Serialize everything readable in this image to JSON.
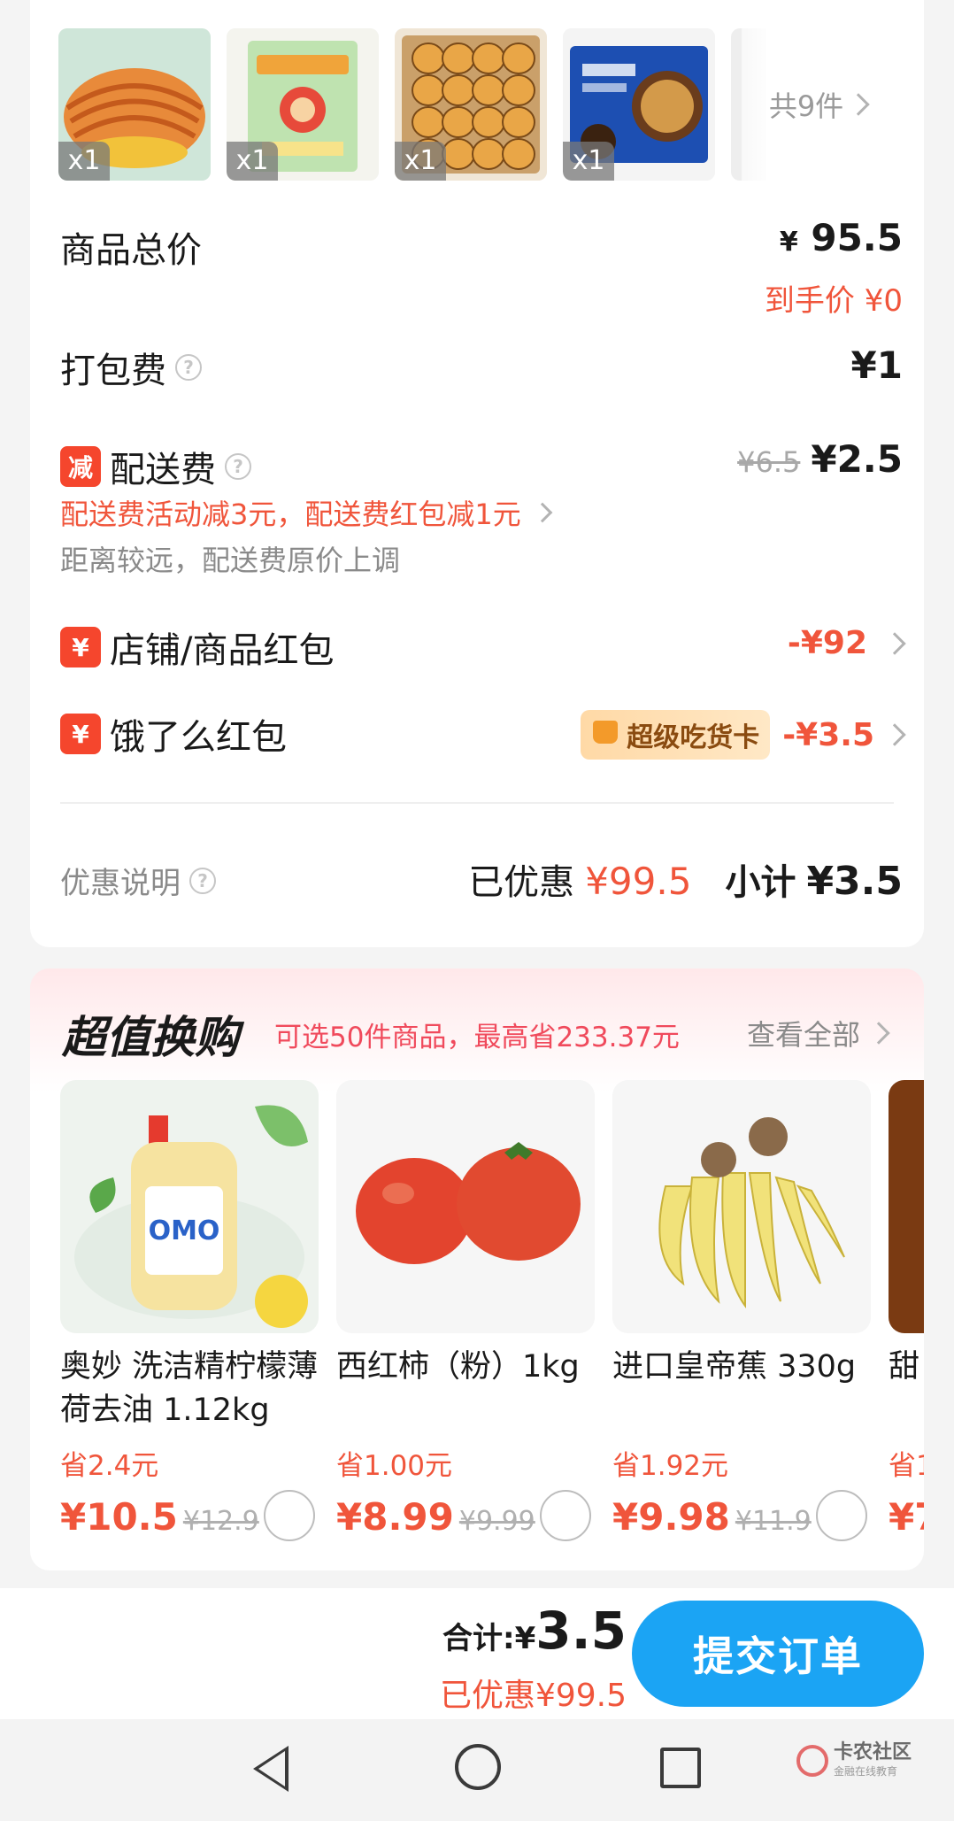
{
  "items": {
    "thumbs": [
      {
        "qty": "x1",
        "name": "pastry"
      },
      {
        "qty": "x1",
        "name": "snack-box"
      },
      {
        "qty": "x1",
        "name": "bread-rolls"
      },
      {
        "qty": "x1",
        "name": "oreo-box"
      }
    ],
    "more_label": "共9件"
  },
  "summary": {
    "goods_total_label": "商品总价",
    "goods_total_currency": "¥",
    "goods_total_value": "95.5",
    "final_price": "到手价 ¥0",
    "packing_label": "打包费",
    "packing_value": "¥1",
    "delivery_badge": "减",
    "delivery_label": "配送费",
    "delivery_original": "¥6.5",
    "delivery_value": "¥2.5",
    "delivery_promo": "配送费活动减3元，配送费红包减1元",
    "delivery_note": "距离较远，配送费原价上调",
    "shop_coupon_badge": "¥",
    "shop_coupon_label": "店铺/商品红包",
    "shop_coupon_value": "-¥92",
    "ele_coupon_badge": "¥",
    "ele_coupon_label": "饿了么红包",
    "super_card": "超级吃货卡",
    "ele_coupon_value": "-¥3.5",
    "discount_info_label": "优惠说明",
    "discounted_label": "已优惠",
    "discounted_value": "¥99.5",
    "subtotal_label": "小计",
    "subtotal_value": "¥3.5"
  },
  "exchange": {
    "title": "超值换购",
    "subtitle": "可选50件商品，最高省233.37元",
    "view_all": "查看全部",
    "products": [
      {
        "name": "奥妙 洗洁精柠檬薄荷去油 1.12kg",
        "save": "省2.4元",
        "price": "¥10.5",
        "orig": "¥12.9"
      },
      {
        "name": "西红柿（粉）1kg",
        "save": "省1.00元",
        "price": "¥8.99",
        "orig": "¥9.99"
      },
      {
        "name": "进口皇帝蕉 330g",
        "save": "省1.92元",
        "price": "¥9.98",
        "orig": "¥11.9"
      },
      {
        "name": "甜",
        "save": "省1",
        "price": "¥7",
        "orig": ""
      }
    ]
  },
  "bottom": {
    "total_label": "合计:¥",
    "total_value": "3.5",
    "saved": "已优惠¥99.5",
    "submit": "提交订单"
  },
  "watermark": {
    "title": "卡农社区",
    "sub": "金融在线教育"
  },
  "colors": {
    "accent_red": "#f0553b",
    "primary_blue": "#1ba4f4"
  }
}
